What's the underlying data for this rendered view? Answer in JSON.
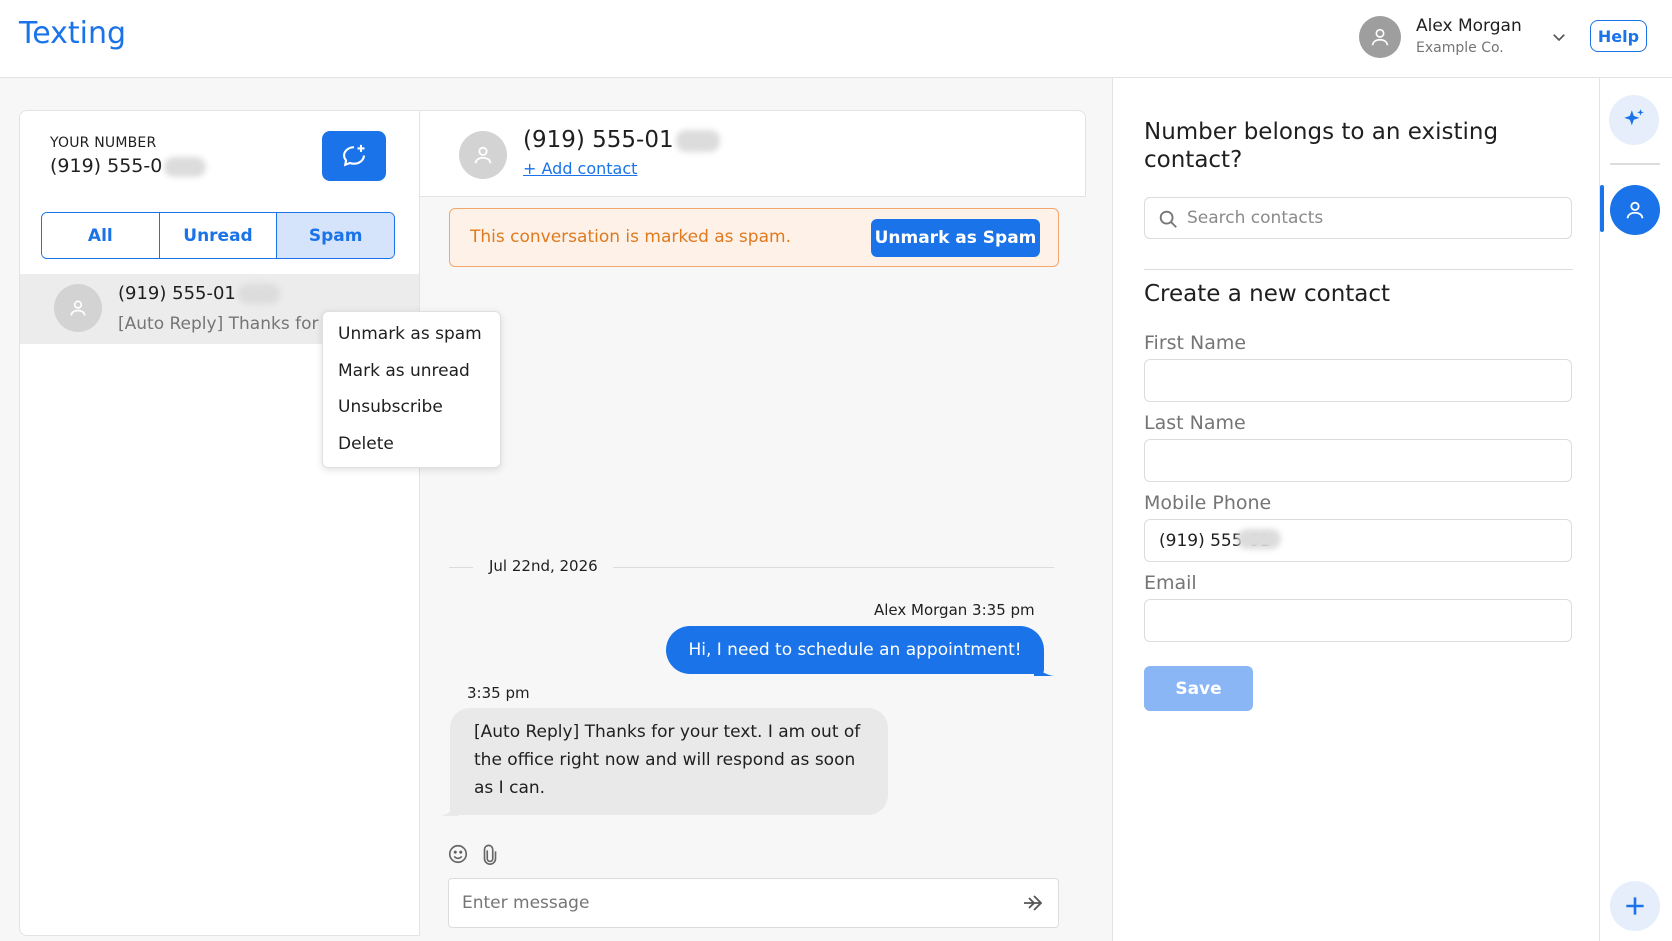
{
  "header": {
    "app_title": "Texting",
    "user_name": "Alex Morgan",
    "user_org": "Example Co.",
    "help_label": "Help"
  },
  "sidebar": {
    "your_number_label": "YOUR NUMBER",
    "your_number_value": "(919) 555-0",
    "tabs": [
      {
        "label": "All",
        "active": false
      },
      {
        "label": "Unread",
        "active": false
      },
      {
        "label": "Spam",
        "active": true
      }
    ],
    "conversations": [
      {
        "number": "(919) 555-01",
        "preview": "[Auto Reply] Thanks for y"
      }
    ]
  },
  "context_menu": {
    "items": [
      "Unmark as spam",
      "Mark as unread",
      "Unsubscribe",
      "Delete"
    ]
  },
  "chat": {
    "contact_number": "(919) 555-01",
    "add_contact_label": "+ Add contact",
    "spam_banner_text": "This conversation is marked as spam.",
    "unmark_button_label": "Unmark as Spam",
    "date_separator": "Jul 22nd, 2026",
    "messages": [
      {
        "direction": "outgoing",
        "meta": "Alex Morgan 3:35 pm",
        "text": "Hi, I need to schedule an appointment!"
      },
      {
        "direction": "incoming",
        "meta": "3:35 pm",
        "text": "[Auto Reply] Thanks for your text. I am out of the office right now and will respond as soon as I can."
      }
    ],
    "input_placeholder": "Enter message"
  },
  "contact_panel": {
    "existing_heading": "Number belongs to an existing contact?",
    "search_placeholder": "Search contacts",
    "new_contact_heading": "Create a new contact",
    "fields": [
      {
        "label": "First Name",
        "value": ""
      },
      {
        "label": "Last Name",
        "value": ""
      },
      {
        "label": "Mobile Phone",
        "value": "(919) 555-01"
      },
      {
        "label": "Email",
        "value": ""
      }
    ],
    "save_label": "Save"
  },
  "colors": {
    "accent": "#1a73e8",
    "spam_text": "#e07a1f",
    "spam_bg": "#fdf1e8",
    "spam_border": "#f4a66c",
    "save_disabled": "#8ab6f5"
  },
  "icons": {
    "user_avatar": "user-icon",
    "new_message": "new-message-icon",
    "dropdown": "chevron-down-icon",
    "search": "search-icon",
    "emoji": "emoji-icon",
    "attach": "paperclip-icon",
    "send": "send-arrow-icon",
    "ai": "sparkle-icon",
    "add": "plus-icon"
  }
}
